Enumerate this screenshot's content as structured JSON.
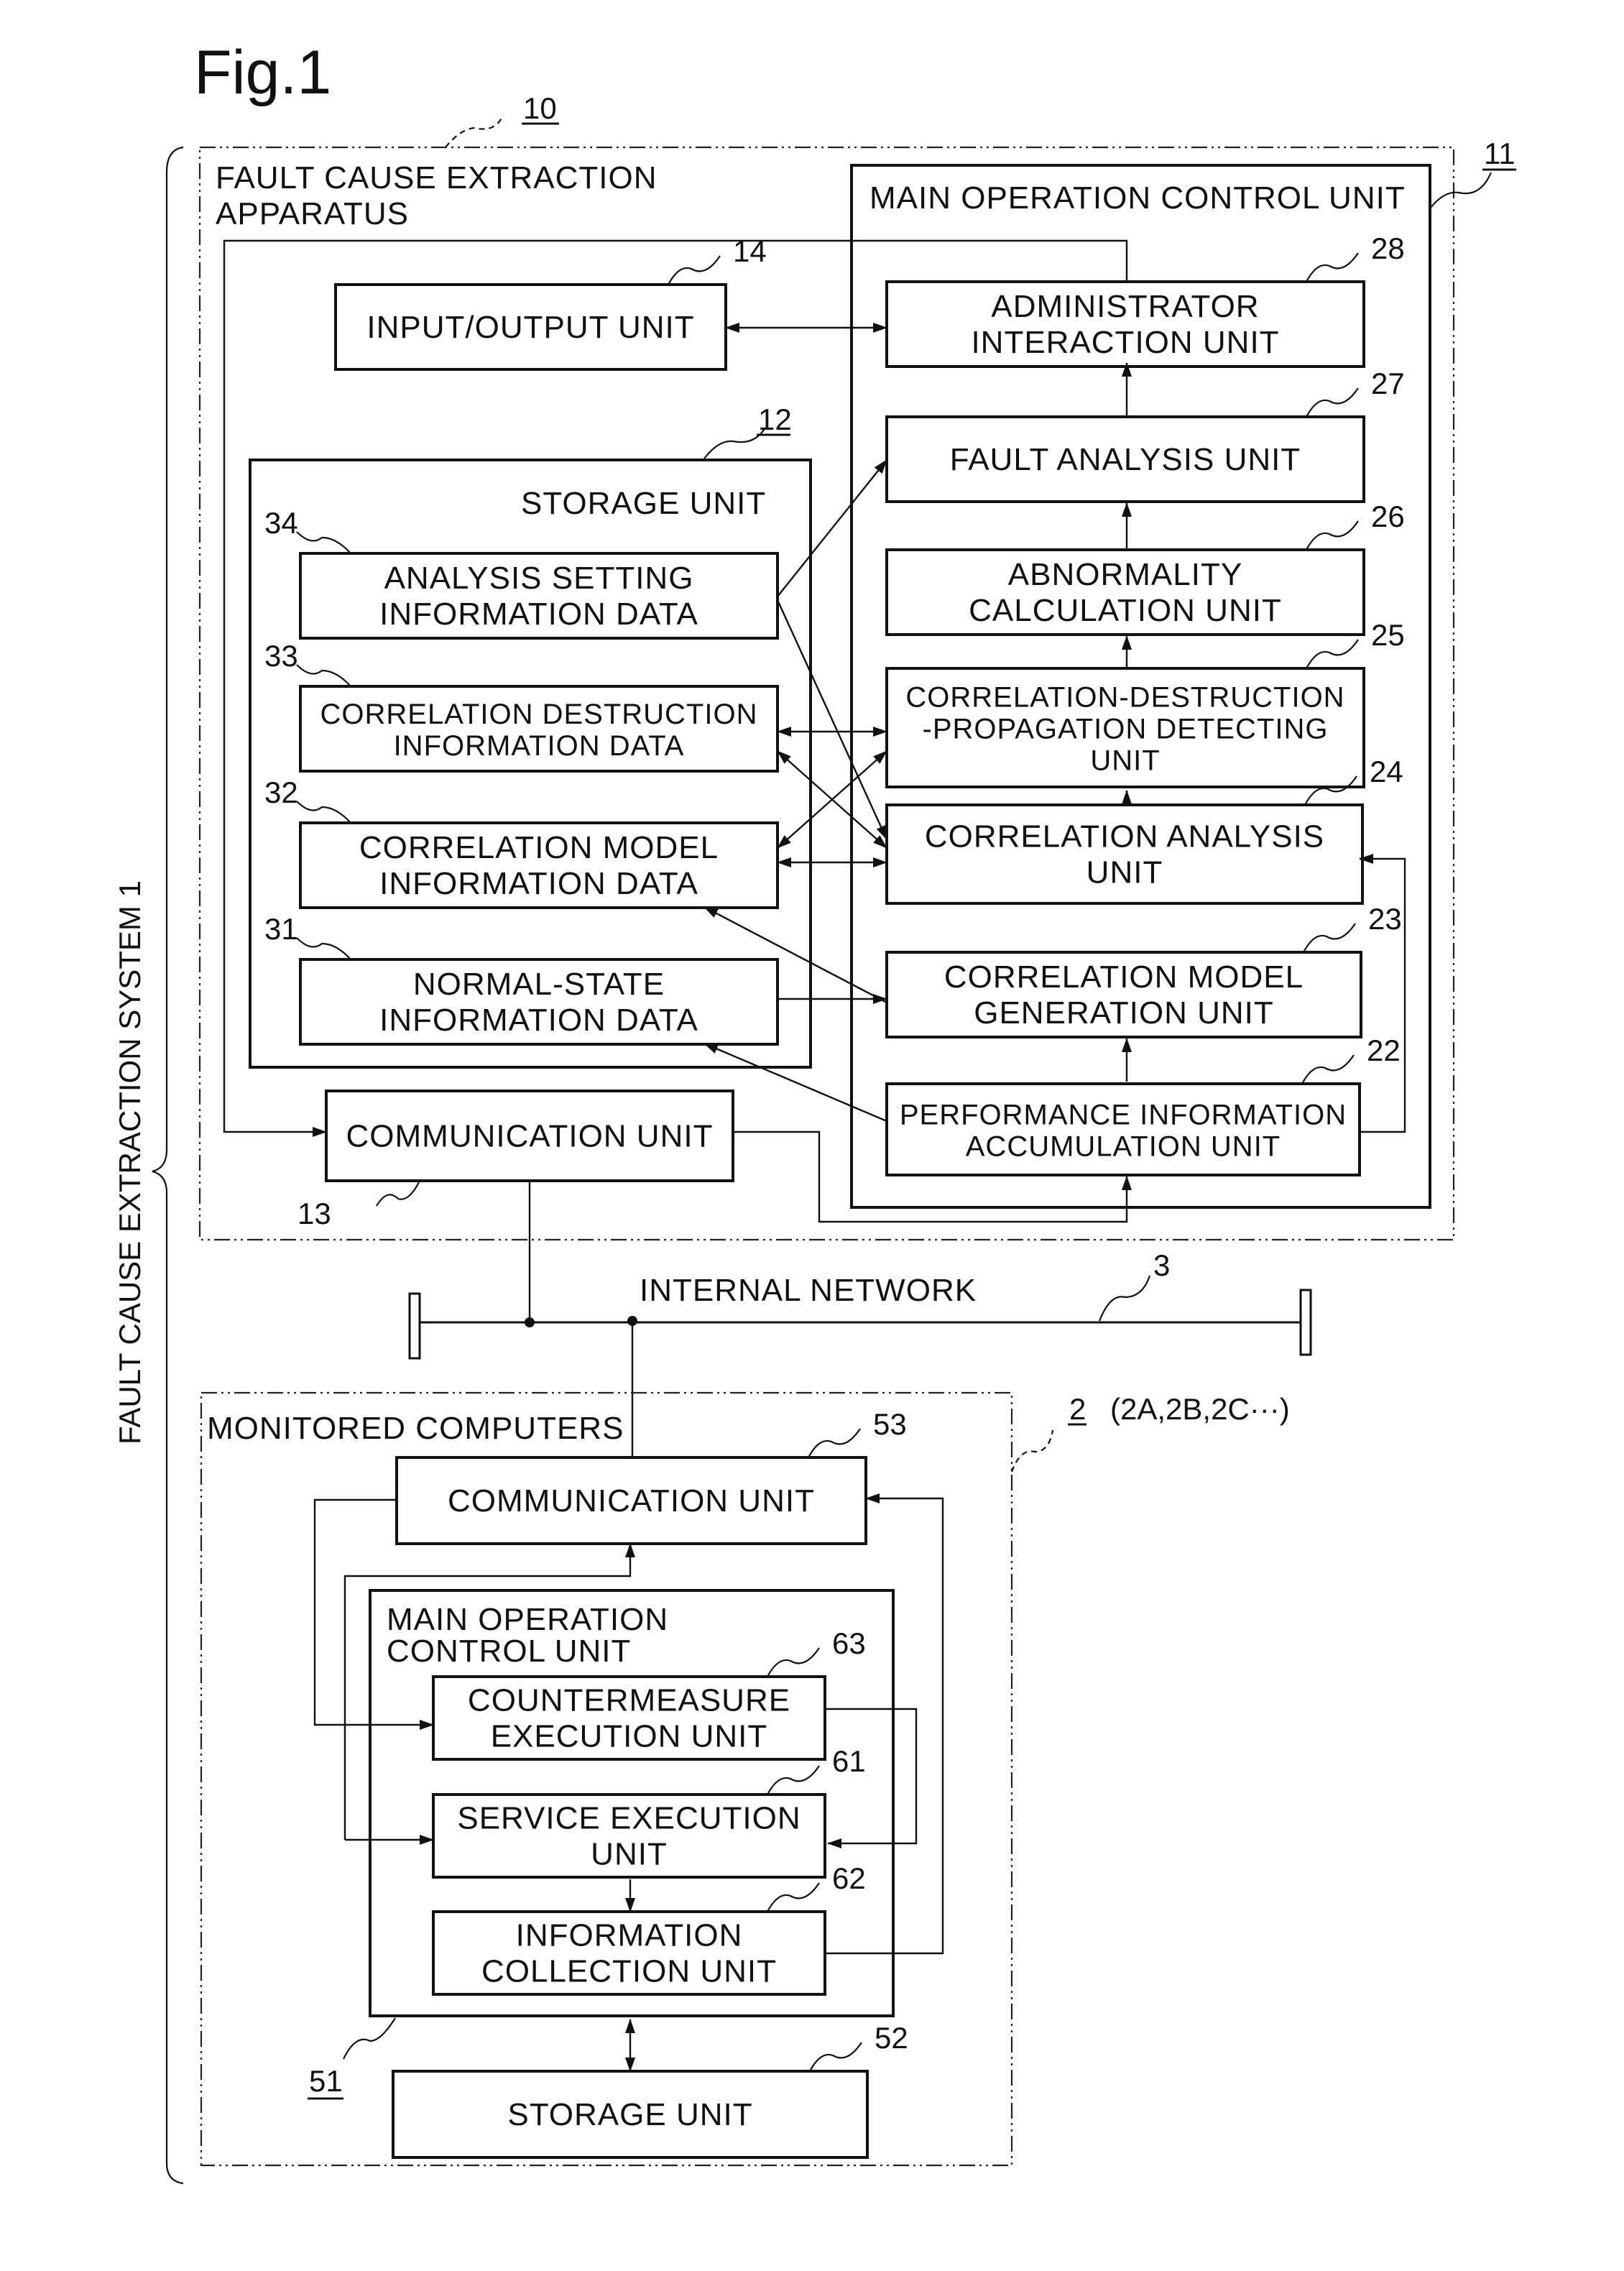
{
  "figure": {
    "title": "Fig.1",
    "system_label": "FAULT CAUSE EXTRACTION SYSTEM  1",
    "apparatus": {
      "ref": "10",
      "label_lines": [
        "FAULT CAUSE EXTRACTION",
        "APPARATUS"
      ]
    },
    "main_control": {
      "ref": "11",
      "label": "MAIN OPERATION CONTROL UNIT"
    },
    "storage": {
      "ref": "12",
      "label": "STORAGE UNIT"
    },
    "network": {
      "ref": "3",
      "label": "INTERNAL NETWORK"
    },
    "monitored": {
      "ref": "2",
      "ref_note": "(2A,2B,2C···)",
      "label": "MONITORED COMPUTERS"
    },
    "monitored_main": {
      "ref": "51",
      "label_lines": [
        "MAIN OPERATION",
        "CONTROL UNIT"
      ]
    }
  },
  "units": {
    "io": {
      "ref": "14",
      "lines": [
        "INPUT/OUTPUT UNIT"
      ]
    },
    "admin": {
      "ref": "28",
      "lines": [
        "ADMINISTRATOR",
        "INTERACTION UNIT"
      ]
    },
    "fault": {
      "ref": "27",
      "lines": [
        "FAULT ANALYSIS UNIT"
      ]
    },
    "abnorm": {
      "ref": "26",
      "lines": [
        "ABNORMALITY",
        "CALCULATION UNIT"
      ]
    },
    "cdp": {
      "ref": "25",
      "lines": [
        "CORRELATION-DESTRUCTION",
        "-PROPAGATION DETECTING",
        "UNIT"
      ]
    },
    "corr_an": {
      "ref": "24",
      "lines": [
        "CORRELATION ANALYSIS",
        "UNIT"
      ]
    },
    "corr_gen": {
      "ref": "23",
      "lines": [
        "CORRELATION MODEL",
        "GENERATION UNIT"
      ]
    },
    "perf": {
      "ref": "22",
      "lines": [
        "PERFORMANCE INFORMATION",
        "ACCUMULATION UNIT"
      ]
    },
    "d34": {
      "ref": "34",
      "lines": [
        "ANALYSIS SETTING",
        "INFORMATION DATA"
      ]
    },
    "d33": {
      "ref": "33",
      "lines": [
        "CORRELATION DESTRUCTION",
        "INFORMATION DATA"
      ]
    },
    "d32": {
      "ref": "32",
      "lines": [
        "CORRELATION MODEL",
        "INFORMATION DATA"
      ]
    },
    "d31": {
      "ref": "31",
      "lines": [
        "NORMAL-STATE",
        "INFORMATION DATA"
      ]
    },
    "comm13": {
      "ref": "13",
      "lines": [
        "COMMUNICATION UNIT"
      ]
    },
    "comm53": {
      "ref": "53",
      "lines": [
        "COMMUNICATION UNIT"
      ]
    },
    "counter": {
      "ref": "63",
      "lines": [
        "COUNTERMEASURE",
        "EXECUTION UNIT"
      ]
    },
    "service": {
      "ref": "61",
      "lines": [
        "SERVICE EXECUTION",
        "UNIT"
      ]
    },
    "infocol": {
      "ref": "62",
      "lines": [
        "INFORMATION",
        "COLLECTION UNIT"
      ]
    },
    "storage52": {
      "ref": "52",
      "lines": [
        "STORAGE UNIT"
      ]
    }
  }
}
